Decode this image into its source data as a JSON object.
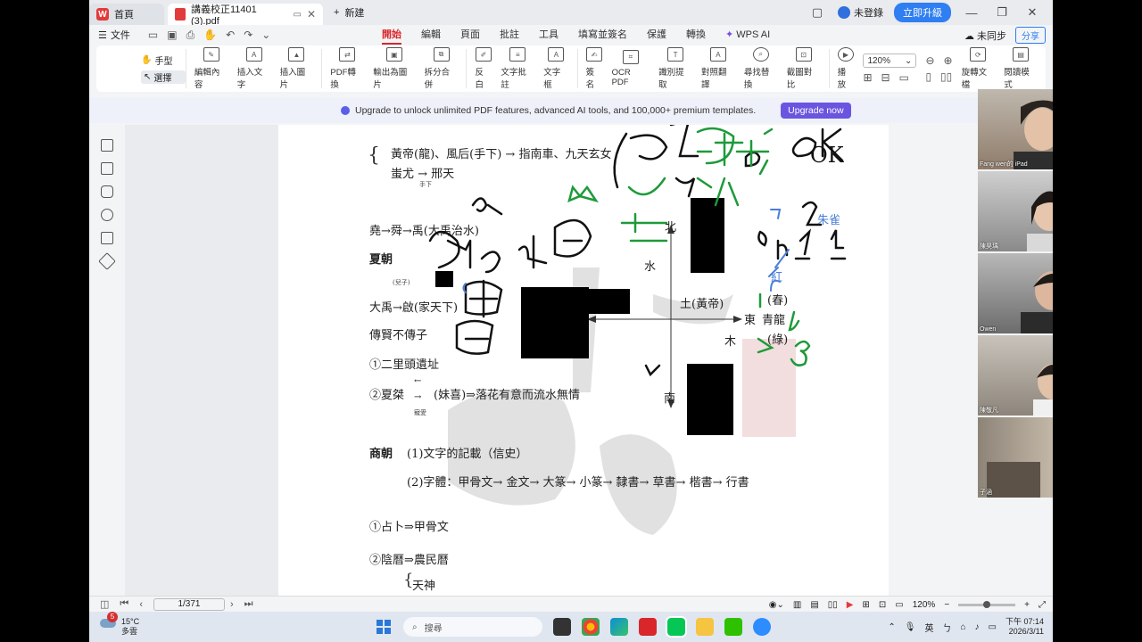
{
  "titlebar": {
    "home_tab": "首頁",
    "doc_tab": "講義校正11401 (3).pdf",
    "new_tab": "新建",
    "login": "未登錄",
    "upgrade": "立即升級"
  },
  "menu": {
    "file": "文件",
    "tabs": [
      "開始",
      "編輯",
      "頁面",
      "批註",
      "工具",
      "填寫並簽名",
      "保護",
      "轉換",
      "WPS AI"
    ],
    "sync": "未同步",
    "share": "分享"
  },
  "ribbon": {
    "hand": "手型",
    "select": "選擇",
    "items": [
      {
        "label": "編輯內容",
        "icon": "edit-content-icon"
      },
      {
        "label": "插入文字",
        "icon": "insert-text-icon"
      },
      {
        "label": "插入圖片",
        "icon": "insert-image-icon"
      },
      {
        "label": "PDF轉換",
        "icon": "pdf-convert-icon"
      },
      {
        "label": "輸出為圖片",
        "icon": "export-image-icon"
      },
      {
        "label": "拆分合併",
        "icon": "split-merge-icon"
      },
      {
        "label": "反白",
        "icon": "highlight-icon"
      },
      {
        "label": "文字批註",
        "icon": "text-comment-icon"
      },
      {
        "label": "文字框",
        "icon": "text-box-icon"
      },
      {
        "label": "簽名",
        "icon": "signature-icon"
      },
      {
        "label": "OCR PDF",
        "icon": "ocr-icon"
      },
      {
        "label": "識別提取",
        "icon": "extract-icon"
      },
      {
        "label": "對照翻譯",
        "icon": "translate-icon"
      },
      {
        "label": "尋找替換",
        "icon": "find-replace-icon"
      },
      {
        "label": "截圖對比",
        "icon": "screenshot-compare-icon"
      },
      {
        "label": "播放",
        "icon": "play-icon"
      }
    ],
    "zoom": "120%",
    "rotate": "旋轉文檔",
    "read_mode": "閱讀模式"
  },
  "banner": {
    "text": "Upgrade to unlock unlimited PDF features, advanced AI tools, and 100,000+ premium templates.",
    "button": "Upgrade now"
  },
  "document": {
    "l1": "黃帝(龍)、風后(手下) →  指南車、九天玄女",
    "l2": "蚩尤 →  邢天",
    "l2_small": "手下",
    "l3": "堯→舜→禹(大禹治水)",
    "l4": "夏朝",
    "l4_small": "(兒子)",
    "l5": "大禹→啟(家天下)",
    "l6": "傳賢不傳子",
    "l7": "①二里頭遺址",
    "l8a": "②夏桀",
    "l8b": "(妹喜)⇒落花有意而流水無情",
    "l8_small": "寵愛",
    "l9a": "商朝",
    "l9b": "(1)文字的記載（信史）",
    "l10": "(2)字體：甲骨文→  金文→  大篆→  小篆→  隸書→  草書→  楷書→  行書",
    "l11": "①占卜⇒甲骨文",
    "l12": "②陰曆⇒農民曆",
    "l13": "天神",
    "compass": {
      "north": "北",
      "south": "南",
      "east": "東",
      "water": "水",
      "earth": "土(黃帝)",
      "wood": "木",
      "dragon": "青龍",
      "spring": "(春)",
      "green": "(綠)"
    },
    "handwriting": {
      "ok": "OK",
      "red": "紅",
      "bird": "朱雀"
    }
  },
  "videos": [
    {
      "name": "Fang wen的 iPad"
    },
    {
      "name": "陳昊瑀"
    },
    {
      "name": "Owen"
    },
    {
      "name": "陳敬凡"
    },
    {
      "name": "子涵"
    }
  ],
  "status": {
    "page": "1/371",
    "zoom": "120%"
  },
  "taskbar": {
    "temp": "15°C",
    "weather": "多雲",
    "badge": "5",
    "search": "搜尋",
    "ime": "英",
    "ime2": "ㄅ",
    "time": "下午 07:14",
    "date": "2026/3/11"
  }
}
